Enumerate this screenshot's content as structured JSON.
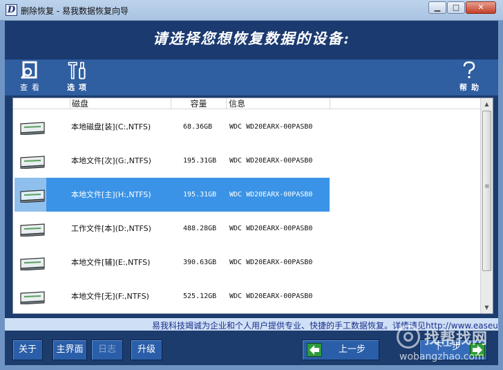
{
  "window": {
    "app_icon": "D",
    "title": "删除恢复 - 易我数据恢复向导",
    "minimize_glyph": "▁",
    "maximize_glyph": "□",
    "close_glyph": "✕"
  },
  "header": {
    "title": "请选择您想恢复数据的设备:"
  },
  "toolbar": {
    "view_label": "查看",
    "options_label": "选项",
    "help_label": "帮助"
  },
  "disk_list": {
    "columns": {
      "disk": "磁盘",
      "capacity": "容量",
      "info": "信息"
    },
    "rows": [
      {
        "name": "本地磁盘[装](C:,NTFS)",
        "capacity": "68.36GB",
        "info": "WDC WD20EARX-00PASB0"
      },
      {
        "name": "本地文件[次](G:,NTFS)",
        "capacity": "195.31GB",
        "info": "WDC WD20EARX-00PASB0"
      },
      {
        "name": "本地文件[主](H:,NTFS)",
        "capacity": "195.31GB",
        "info": "WDC WD20EARX-00PASB0"
      },
      {
        "name": "工作文件[本](D:,NTFS)",
        "capacity": "488.28GB",
        "info": "WDC WD20EARX-00PASB0"
      },
      {
        "name": "本地文件[辅](E:,NTFS)",
        "capacity": "390.63GB",
        "info": "WDC WD20EARX-00PASB0"
      },
      {
        "name": "本地文件[无](F:,NTFS)",
        "capacity": "525.12GB",
        "info": "WDC WD20EARX-00PASB0"
      }
    ],
    "selected_index": 2
  },
  "status": {
    "text": "易我科技竭诚为企业和个人用户提供专业、快捷的手工数据恢复。详情请见http://www.easeus"
  },
  "buttons": {
    "about": "关于",
    "main": "主界面",
    "log": "日志",
    "upgrade": "升级",
    "prev": "上一步",
    "next": "下一步"
  },
  "watermark": {
    "text": "找帮找网",
    "url": "wobangzhao.com"
  },
  "colors": {
    "banner": "#1b3a70",
    "toolbar": "#2f5ea1",
    "selection": "#3a93e6",
    "status_text": "#1b2f8c"
  }
}
